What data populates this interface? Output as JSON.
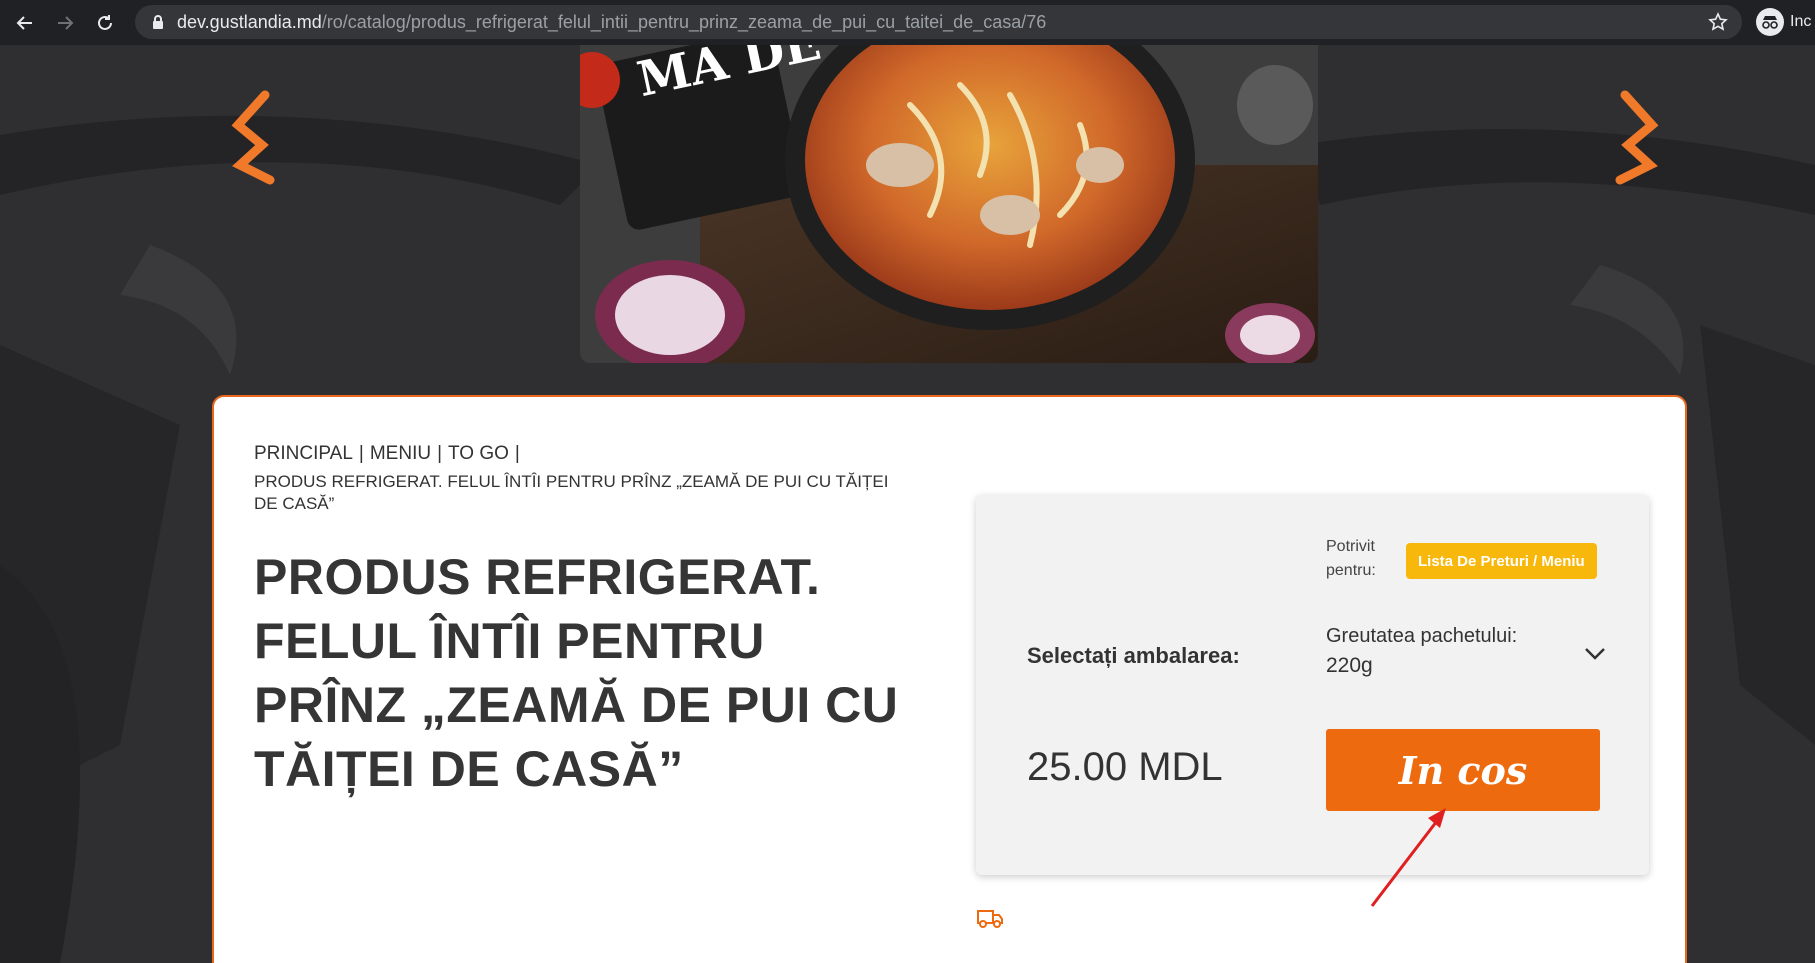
{
  "browser": {
    "url_host": "dev.gustlandia.md",
    "url_path": "/ro/catalog/produs_refrigerat_felul_intii_pentru_prinz_zeama_de_pui_cu_taitei_de_casa/76",
    "profile_label": "Inc"
  },
  "breadcrumb": {
    "items": [
      "PRINCIPAL",
      "MENIU",
      "TO GO"
    ],
    "separator": "|",
    "current": "PRODUS REFRIGERAT. FELUL ÎNTÎI PENTRU PRÎNZ „ZEAMĂ DE PUI CU TĂIȚEI DE CASĂ”"
  },
  "product": {
    "title": "PRODUS REFRIGERAT. FELUL ÎNTÎI PENTRU PRÎNZ „ZEAMĂ DE PUI CU TĂIȚEI DE CASĂ”",
    "image_label": "MĂ DE PUI"
  },
  "buy_panel": {
    "suitable_label": "Potrivit pentru:",
    "price_list_badge": "Lista De Preturi / Meniu",
    "select_label": "Selectați ambalarea:",
    "package_label": "Greutatea pachetului:",
    "package_value": "220g",
    "price": "25.00 MDL",
    "cart_button": "In cos"
  },
  "colors": {
    "accent": "#ee6a0e",
    "badge": "#f8b70b",
    "background": "#2f2f31",
    "annotation_arrow": "#e02020"
  }
}
